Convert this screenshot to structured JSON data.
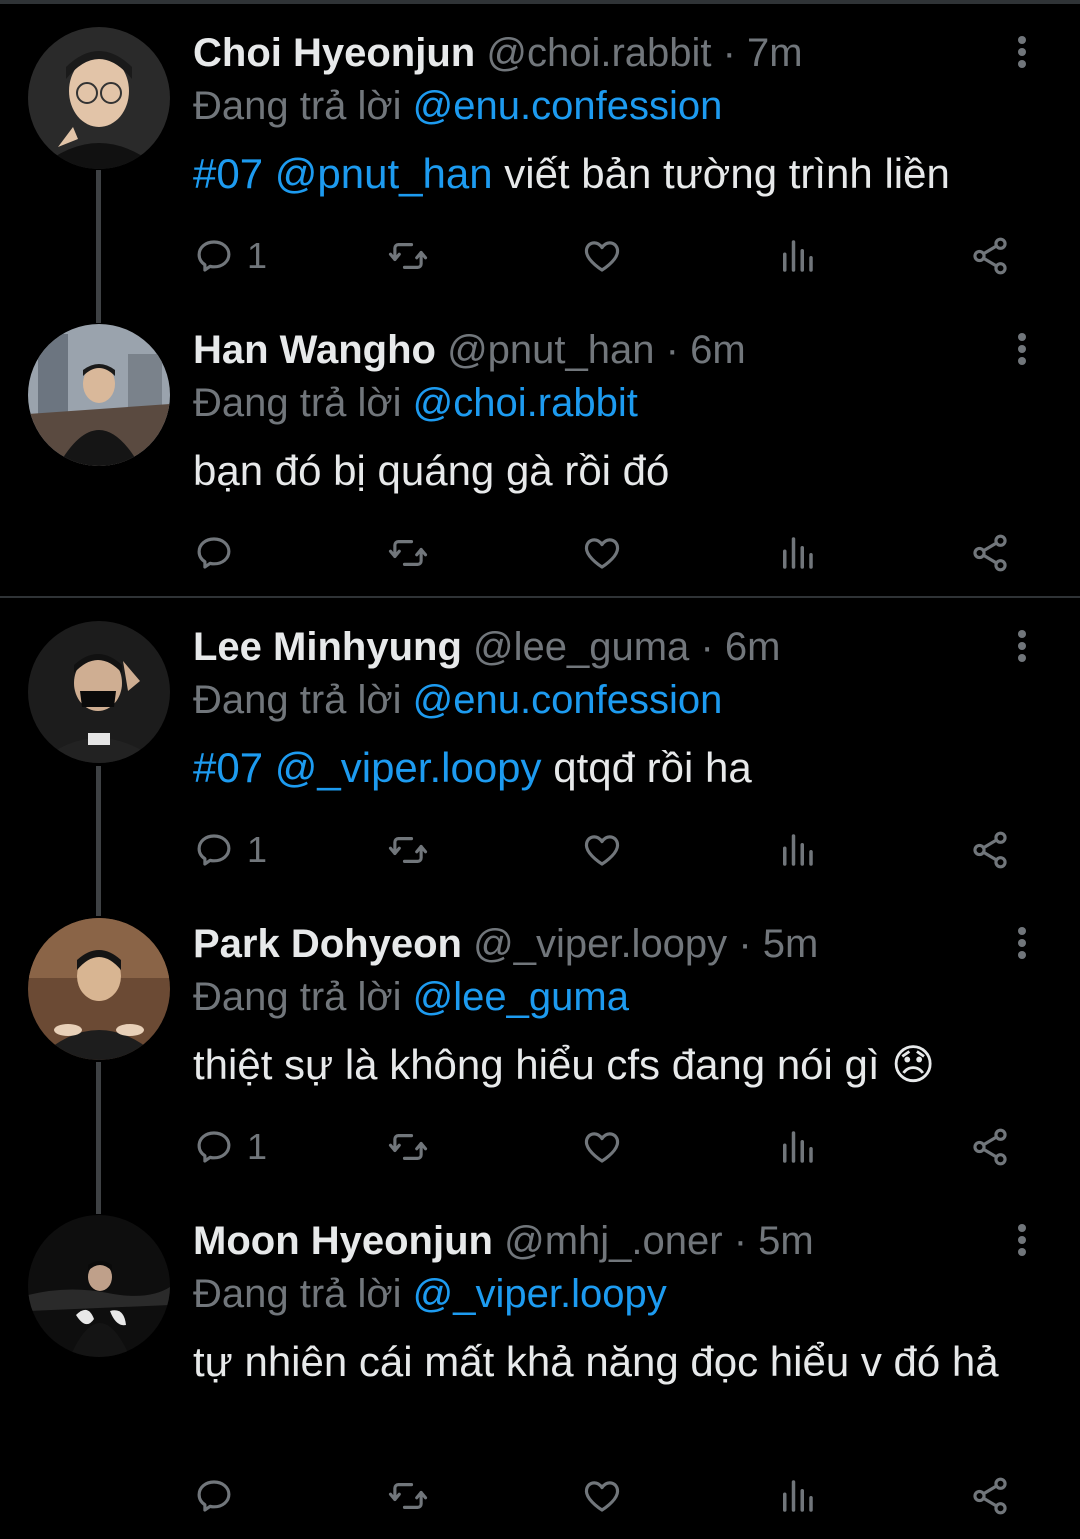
{
  "labels": {
    "replying_prefix": "Đang trả lời"
  },
  "tweets": [
    {
      "name": "Choi Hyeonjun",
      "handle": "@choi.rabbit",
      "time": "· 7m",
      "replying_to": "@enu.confession",
      "text_tag": "#07",
      "text_mention": "@pnut_han",
      "text_body": " viết bản tường trình liền",
      "reply_count": "1"
    },
    {
      "name": "Han Wangho",
      "handle": "@pnut_han",
      "time": "· 6m",
      "replying_to": "@choi.rabbit",
      "text_body": "bạn đó bị quáng gà rồi đó",
      "reply_count": ""
    },
    {
      "name": "Lee Minhyung",
      "handle": "@lee_guma",
      "time": "· 6m",
      "replying_to": "@enu.confession",
      "text_tag": "#07",
      "text_mention": "@_viper.loopy",
      "text_body": " qtqđ rồi ha",
      "reply_count": "1"
    },
    {
      "name": "Park Dohyeon",
      "handle": "@_viper.loopy",
      "time": "· 5m",
      "replying_to": "@lee_guma",
      "text_body": "thiệt sự là không hiểu cfs đang nói gì 😞",
      "reply_count": "1"
    },
    {
      "name": "Moon Hyeonjun",
      "handle": "@mhj_.oner",
      "time": "· 5m",
      "replying_to": "@_viper.loopy",
      "text_body": "tự nhiên cái mất khả năng đọc hiểu v đó hả",
      "reply_count": ""
    }
  ],
  "icons": [
    "reply-icon",
    "retweet-icon",
    "like-icon",
    "views-icon",
    "share-icon",
    "more-icon"
  ],
  "colors": {
    "background": "#000000",
    "text": "#e7e9ea",
    "muted": "#71767b",
    "link": "#1d9bf0",
    "divider": "#2f3336"
  }
}
